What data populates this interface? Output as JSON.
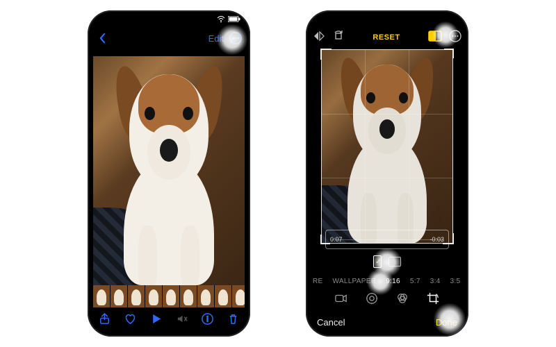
{
  "colors": {
    "accent_blue": "#2f6af5",
    "accent_yellow": "#ffcc00"
  },
  "status": {
    "time": "",
    "wifi": "wifi-icon",
    "battery": "battery-icon"
  },
  "viewer": {
    "back_icon": "chevron-left-icon",
    "edit_label": "Edit",
    "more_icon": "ellipsis-circle-icon",
    "toolbar": {
      "share": "share-icon",
      "favorite": "heart-icon",
      "play": "play-icon",
      "mute": "speaker-mute-icon",
      "info": "info-circle-icon",
      "trash": "trash-icon"
    }
  },
  "editor": {
    "flip_icon": "flip-horizontal-icon",
    "rotate_icon": "rotate-icon",
    "reset_label": "RESET",
    "aspect_icon": "aspect-ratio-icon",
    "more_icon": "ellipsis-circle-icon",
    "scrub_start": "0:07",
    "scrub_end": "-0:03",
    "orientation": {
      "portrait_selected": true
    },
    "ratios": [
      "RE",
      "WALLPAPER",
      "9:16",
      "5:7",
      "3:4",
      "3:5"
    ],
    "ratio_selected": "9:16",
    "modes": {
      "video": "video-icon",
      "adjust": "adjust-dial-icon",
      "filters": "filters-icon",
      "crop": "crop-rotate-icon"
    },
    "cancel_label": "Cancel",
    "done_label": "Done"
  }
}
